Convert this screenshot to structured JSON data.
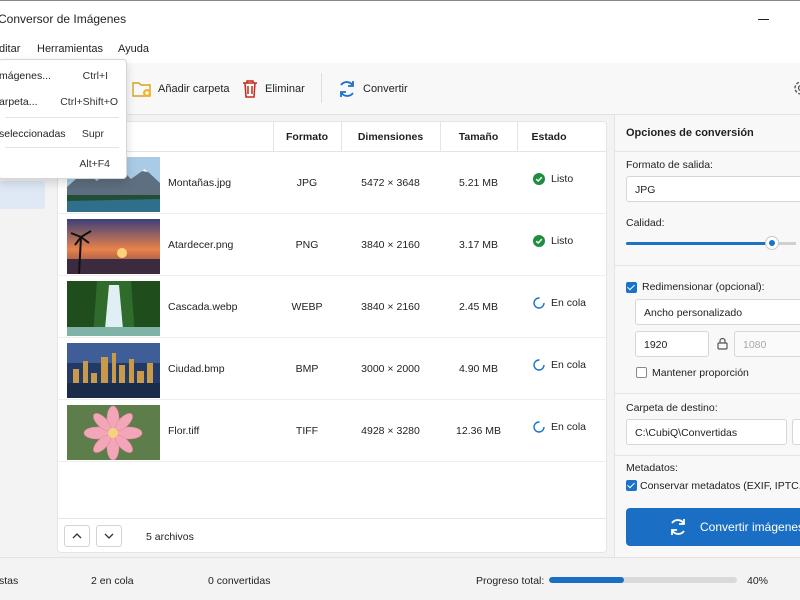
{
  "window": {
    "title": "Conversor de Imágenes"
  },
  "menu": {
    "items": [
      "ditar",
      "Herramientas",
      "Ayuda"
    ]
  },
  "file_menu": {
    "items": [
      {
        "label": "mágenes...",
        "shortcut": "Ctrl+I"
      },
      {
        "label": "arpeta...",
        "shortcut": "Ctrl+Shift+O"
      },
      {
        "label": "seleccionadas",
        "shortcut": "Supr"
      },
      {
        "label": "",
        "shortcut": "Alt+F4"
      }
    ]
  },
  "toolbar": {
    "add_folder": "Añadir carpeta",
    "delete": "Eliminar",
    "convert": "Convertir"
  },
  "table": {
    "headers": {
      "format": "Formato",
      "dimensions": "Dimensiones",
      "size": "Tamaño",
      "status": "Estado"
    },
    "rows": [
      {
        "name": "Montañas.jpg",
        "format": "JPG",
        "dimensions": "5472 × 3648",
        "size": "5.21 MB",
        "status": "Listo",
        "state": "done"
      },
      {
        "name": "Atardecer.png",
        "format": "PNG",
        "dimensions": "3840 × 2160",
        "size": "3.17 MB",
        "status": "Listo",
        "state": "done"
      },
      {
        "name": "Cascada.webp",
        "format": "WEBP",
        "dimensions": "3840 × 2160",
        "size": "2.45 MB",
        "status": "En cola",
        "state": "queued"
      },
      {
        "name": "Ciudad.bmp",
        "format": "BMP",
        "dimensions": "3000 × 2000",
        "size": "4.90 MB",
        "status": "En cola",
        "state": "queued"
      },
      {
        "name": "Flor.tiff",
        "format": "TIFF",
        "dimensions": "4928 × 3280",
        "size": "12.36 MB",
        "status": "En cola",
        "state": "queued"
      }
    ],
    "count": "5 archivos"
  },
  "options": {
    "title": "Opciones de conversión",
    "format_label": "Formato de salida:",
    "format_value": "JPG",
    "quality_label": "Calidad:",
    "quality_level": 0.89,
    "resize_label": "Redimensionar (opcional):",
    "resize_checked": true,
    "resize_mode": "Ancho personalizado",
    "width": "1920",
    "height": "1080",
    "keep_ratio_label": "Mantener proporción",
    "keep_ratio_checked": false,
    "dest_label": "Carpeta de destino:",
    "dest_value": "C:\\CubiQ\\Convertidas",
    "meta_label": "Metadatos:",
    "meta_check_label": "Conservar metadatos (EXIF, IPTC, XM",
    "meta_checked": true,
    "convert_button": "Convertir imágenes"
  },
  "statusbar": {
    "ready": "stas",
    "queued": "2 en cola",
    "converted": "0 convertidas",
    "progress_label": "Progreso total:",
    "progress_value": 0.4,
    "progress_text": "40%"
  },
  "colors": {
    "accent": "#1a6fc4",
    "done": "#1e8e3e",
    "queued": "#1a73c9",
    "delete": "#c42b1c",
    "folder": "#d9a21b"
  }
}
